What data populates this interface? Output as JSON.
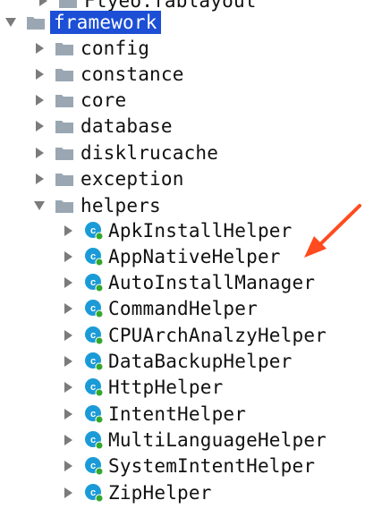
{
  "tree": {
    "partial_top_item": "Ftyeo.fablayout",
    "selected_folder": "framework",
    "folders": [
      {
        "label": "config"
      },
      {
        "label": "constance"
      },
      {
        "label": "core"
      },
      {
        "label": "database"
      },
      {
        "label": "disklrucache"
      },
      {
        "label": "exception"
      }
    ],
    "open_folder": "helpers",
    "classes": [
      {
        "label": "ApkInstallHelper"
      },
      {
        "label": "AppNativeHelper"
      },
      {
        "label": "AutoInstallManager"
      },
      {
        "label": "CommandHelper"
      },
      {
        "label": "CPUArchAnalzyHelper"
      },
      {
        "label": "DataBackupHelper"
      },
      {
        "label": "HttpHelper"
      },
      {
        "label": "IntentHelper"
      },
      {
        "label": "MultiLanguageHelper"
      },
      {
        "label": "SystemIntentHelper"
      },
      {
        "label": "ZipHelper"
      }
    ]
  },
  "icons": {
    "collapsed": "chevron-right-icon",
    "expanded": "chevron-down-icon",
    "folder": "folder-icon",
    "class": "class-icon",
    "annotation": "red-pointer-arrow-icon"
  },
  "colors": {
    "selection": "#1c4fd6",
    "folder": "#9aa7b3",
    "class_icon": "#1a9bd7",
    "class_badge": "#34a82e",
    "arrow": "#ff4b1f"
  }
}
